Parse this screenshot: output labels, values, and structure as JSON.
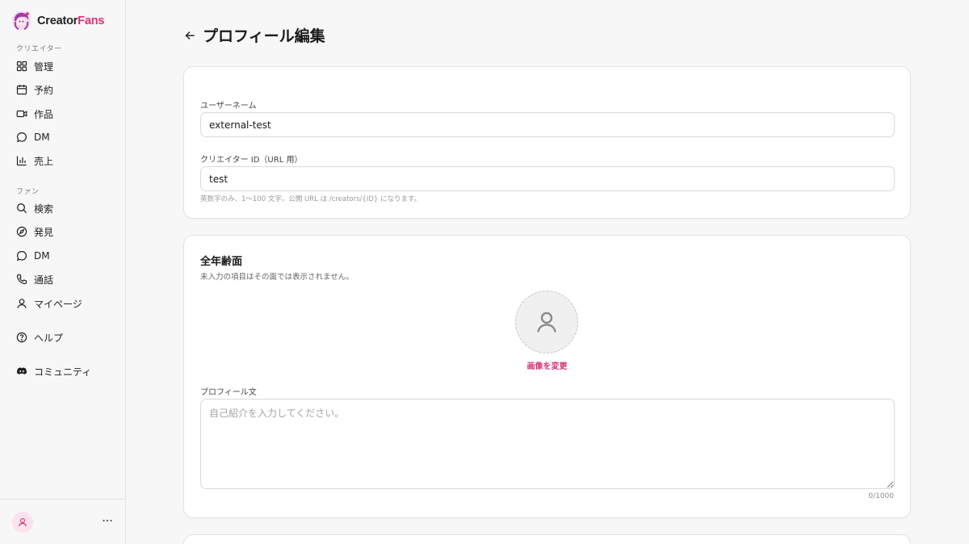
{
  "brand": {
    "name_part1": "Creator",
    "name_part2": "Fans",
    "accent": "#e0307a"
  },
  "sidebar": {
    "creator_label": "クリエイター",
    "creator_items": [
      {
        "label": "管理",
        "icon": "grid-icon"
      },
      {
        "label": "予約",
        "icon": "calendar-icon"
      },
      {
        "label": "作品",
        "icon": "video-icon"
      },
      {
        "label": "DM",
        "icon": "chat-icon"
      },
      {
        "label": "売上",
        "icon": "bar-chart-icon"
      }
    ],
    "fan_label": "ファン",
    "fan_items": [
      {
        "label": "検索",
        "icon": "search-icon"
      },
      {
        "label": "発見",
        "icon": "compass-icon"
      },
      {
        "label": "DM",
        "icon": "chat-icon"
      },
      {
        "label": "通話",
        "icon": "phone-icon"
      },
      {
        "label": "マイページ",
        "icon": "user-icon"
      }
    ],
    "help_label": "ヘルプ",
    "community_label": "コミュニティ"
  },
  "page": {
    "title": "プロフィール編集"
  },
  "account_card": {
    "username_label": "ユーザーネーム",
    "username_value": "external-test",
    "creator_id_label": "クリエイター ID（URL 用）",
    "creator_id_value": "test",
    "creator_id_hint": "英数字のみ、1〜100 文字。公開 URL は /creators/{ID} になります。"
  },
  "profile_card": {
    "title": "全年齢面",
    "description": "未入力の項目はその面では表示されません。",
    "change_image_label": "画像を変更",
    "bio_label": "プロフィール文",
    "bio_placeholder": "自己紹介を入力してください。",
    "bio_value": "",
    "bio_counter": "0/1000"
  }
}
